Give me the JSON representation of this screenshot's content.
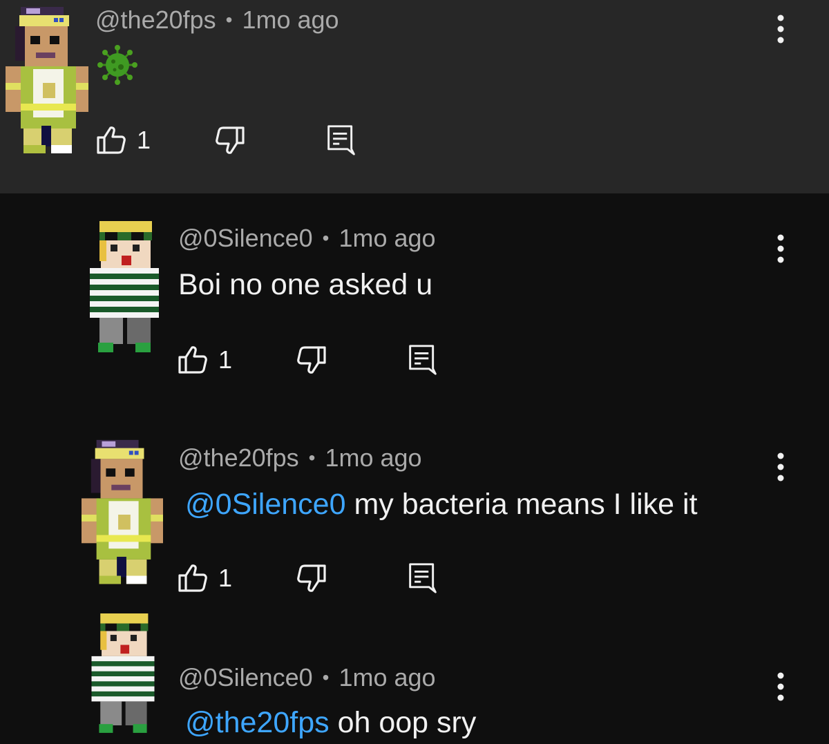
{
  "comments": [
    {
      "handle": "@the20fps",
      "separator": "•",
      "time": "1mo ago",
      "body_emoji": "virus-emoji",
      "likes": "1"
    },
    {
      "handle": "@0Silence0",
      "separator": "•",
      "time": "1mo ago",
      "body": "Boi no one asked u",
      "likes": "1"
    },
    {
      "handle": "@the20fps",
      "separator": "•",
      "time": "1mo ago",
      "mention": "@0Silence0",
      "body": " my bacteria means I like it",
      "likes": "1"
    },
    {
      "handle": "@0Silence0",
      "separator": "•",
      "time": "1mo ago",
      "mention": "@the20fps",
      "body": " oh oop sry"
    }
  ],
  "icons": {
    "like": "thumbs-up-icon",
    "dislike": "thumbs-down-icon",
    "reply": "reply-icon",
    "more": "more-vert-icon"
  },
  "colors": {
    "background": "#0f0f0f",
    "parent_highlight": "#272727",
    "mention": "#3ea6ff",
    "meta_text": "#aaaaaa"
  }
}
